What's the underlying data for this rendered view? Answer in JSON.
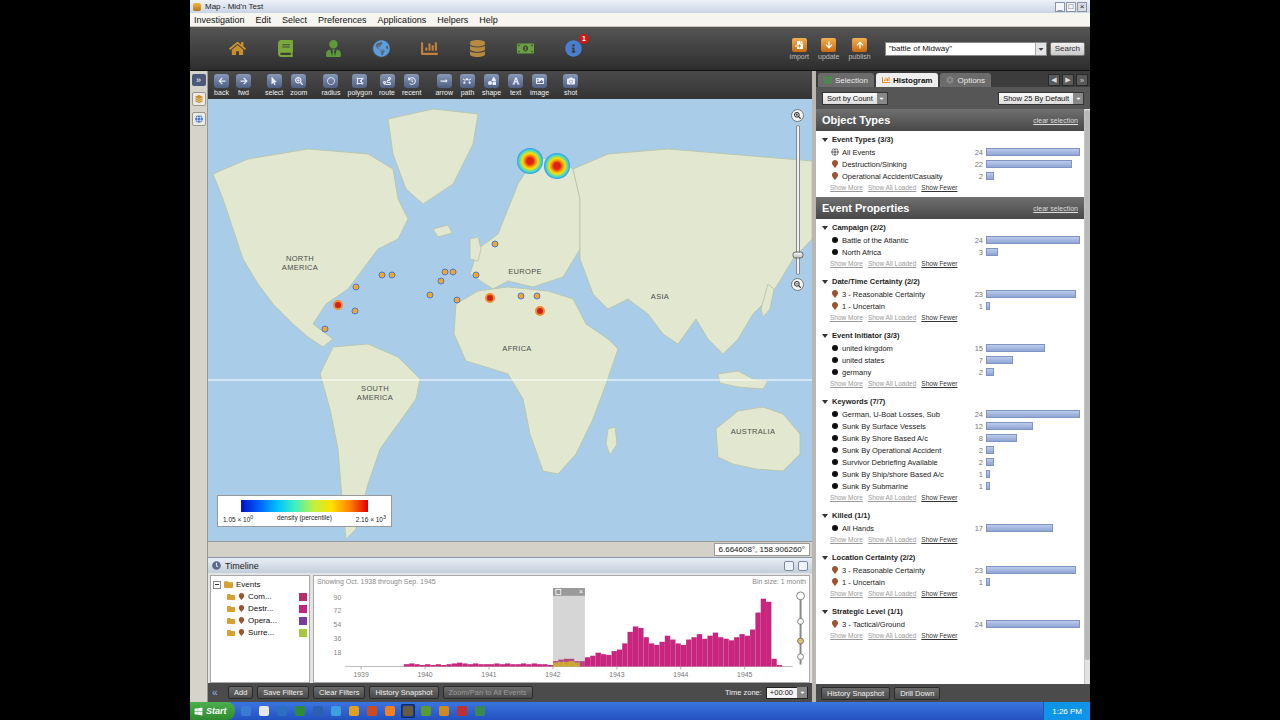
{
  "window": {
    "title": "Map - Mid'n Test",
    "controls": [
      "_",
      "□",
      "×"
    ]
  },
  "menu": [
    "Investigation",
    "Edit",
    "Select",
    "Preferences",
    "Applications",
    "Helpers",
    "Help"
  ],
  "toolbar": {
    "apps": [
      {
        "kind": "home",
        "selected": false
      },
      {
        "kind": "book",
        "selected": false
      },
      {
        "kind": "person",
        "selected": false
      },
      {
        "kind": "globe",
        "selected": true
      },
      {
        "kind": "chart",
        "selected": false
      },
      {
        "kind": "barrel",
        "selected": false
      },
      {
        "kind": "money",
        "selected": false
      },
      {
        "kind": "info",
        "selected": false,
        "badge": "1"
      }
    ],
    "actions": [
      {
        "kind": "import",
        "label": "import"
      },
      {
        "kind": "update",
        "label": "update"
      },
      {
        "kind": "publish",
        "label": "publish"
      }
    ],
    "search": {
      "value": "\"battle of Midway\"",
      "button": "Search"
    }
  },
  "side_strip": {
    "collapse": "»"
  },
  "map_toolbar": [
    [
      {
        "kind": "back",
        "label": "back"
      },
      {
        "kind": "fwd",
        "label": "fwd"
      }
    ],
    [
      {
        "kind": "select",
        "label": "select"
      },
      {
        "kind": "zoom",
        "label": "zoom"
      }
    ],
    [
      {
        "kind": "radius",
        "label": "radius"
      },
      {
        "kind": "polygon",
        "label": "polygon"
      },
      {
        "kind": "route",
        "label": "route"
      },
      {
        "kind": "recent",
        "label": "recent"
      }
    ],
    [
      {
        "kind": "arrow",
        "label": "arrow"
      },
      {
        "kind": "path",
        "label": "path"
      },
      {
        "kind": "shape",
        "label": "shape"
      },
      {
        "kind": "text",
        "label": "text"
      },
      {
        "kind": "image",
        "label": "image"
      }
    ],
    [
      {
        "kind": "shot",
        "label": "shot"
      }
    ]
  ],
  "map": {
    "labels": [
      {
        "label": "NORTH AMERICA",
        "lon": -90,
        "lat": 44.6
      },
      {
        "label": "EUROPE",
        "lon": 22.5,
        "lat": 41.8
      },
      {
        "label": "ASIA",
        "lon": 90,
        "lat": 31.7
      },
      {
        "label": "AFRICA",
        "lon": 18.5,
        "lat": 7.5
      },
      {
        "label": "SOUTH AMERICA",
        "lon": -52.5,
        "lat": -14.9
      },
      {
        "label": "AUSTRALIA",
        "lon": 136.5,
        "lat": -32.2
      }
    ],
    "pins": [
      {
        "kind": "heat",
        "lon": 25,
        "lat": 70.7,
        "color": "#e0201a"
      },
      {
        "kind": "heat",
        "lon": 38.5,
        "lat": 69.9,
        "color": "#e0201a"
      },
      {
        "kind": "point",
        "lon": 7.5,
        "lat": 51.3,
        "color": "#f5a623"
      },
      {
        "kind": "point",
        "lon": -49,
        "lat": 40.6,
        "color": "#f5a623"
      },
      {
        "kind": "point",
        "lon": -44,
        "lat": 40.6,
        "color": "#f5a623"
      },
      {
        "kind": "point",
        "lon": -17.5,
        "lat": 41.8,
        "color": "#f5a623"
      },
      {
        "kind": "point",
        "lon": -13.5,
        "lat": 41.8,
        "color": "#f5a623"
      },
      {
        "kind": "point",
        "lon": -2,
        "lat": 40.6,
        "color": "#f5a623"
      },
      {
        "kind": "point",
        "lon": -62,
        "lat": 35.8,
        "color": "#f5a623"
      },
      {
        "kind": "point",
        "lon": -19.5,
        "lat": 38.2,
        "color": "#f5a623"
      },
      {
        "kind": "point",
        "lon": -25,
        "lat": 32.6,
        "color": "#f5a623"
      },
      {
        "kind": "point",
        "lon": -11.5,
        "lat": 30.4,
        "color": "#f5a623"
      },
      {
        "kind": "major",
        "lon": 5,
        "lat": 31.3,
        "color": "#d0201a"
      },
      {
        "kind": "point",
        "lon": 20.5,
        "lat": 32.2,
        "color": "#f5a623"
      },
      {
        "kind": "point",
        "lon": 28.5,
        "lat": 32.2,
        "color": "#f5a623"
      },
      {
        "kind": "major",
        "lon": 30,
        "lat": 25.6,
        "color": "#d0201a"
      },
      {
        "kind": "major",
        "lon": -71,
        "lat": 28.2,
        "color": "#d0201a"
      },
      {
        "kind": "point",
        "lon": -62.5,
        "lat": 25.6,
        "color": "#f5a623"
      },
      {
        "kind": "point",
        "lon": -77.5,
        "lat": 17.3,
        "color": "#f5a623"
      }
    ],
    "legend": {
      "min_base": "1.05 × 10",
      "min_exp": "0",
      "caption": "density (percentile)",
      "max_base": "2.16 × 10",
      "max_exp": "3"
    },
    "zoom": {
      "level": 0.13
    },
    "coordinates": "6.664608°, 158.906260°"
  },
  "timeline": {
    "title": "Timeline",
    "tree": {
      "label": "Events",
      "expanded": true,
      "children": [
        {
          "label": "Com...",
          "color": "#b8306a"
        },
        {
          "label": "Destr...",
          "color": "#c0267e"
        },
        {
          "label": "Opera...",
          "color": "#7a3aa0"
        },
        {
          "label": "Surre...",
          "color": "#a8c83c"
        }
      ]
    },
    "range": "Showing Oct. 1938 through Sep. 1945",
    "bin": "Bin size: 1 month",
    "y_ticks": [
      "90",
      "72",
      "54",
      "36",
      "18"
    ],
    "x_ticks": [
      "1939",
      "1940",
      "1941",
      "1942",
      "1943",
      "1944",
      "1945"
    ],
    "series": [
      {
        "name": "Events",
        "color": "#c8267e",
        "values": [
          0,
          0,
          0,
          0,
          0,
          0,
          0,
          0,
          0,
          0,
          0,
          3,
          4,
          3,
          2,
          3,
          2,
          3,
          2,
          3,
          4,
          5,
          4,
          3,
          4,
          3,
          3,
          3,
          4,
          3,
          4,
          3,
          3,
          4,
          3,
          4,
          3,
          3,
          2,
          2,
          3,
          4,
          3,
          2,
          7,
          12,
          14,
          18,
          16,
          15,
          20,
          22,
          30,
          45,
          52,
          50,
          38,
          30,
          28,
          32,
          40,
          35,
          30,
          28,
          35,
          38,
          42,
          36,
          40,
          44,
          38,
          36,
          34,
          38,
          42,
          40,
          48,
          70,
          88,
          84,
          10,
          2,
          0,
          0
        ]
      },
      {
        "name": "Selection",
        "color": "#f0b400",
        "values": [
          0,
          0,
          0,
          0,
          0,
          0,
          0,
          0,
          0,
          0,
          0,
          0,
          0,
          0,
          0,
          0,
          0,
          0,
          0,
          0,
          0,
          0,
          0,
          0,
          0,
          0,
          0,
          0,
          0,
          0,
          0,
          0,
          0,
          0,
          0,
          0,
          0,
          0,
          0,
          5,
          6,
          6,
          7,
          5,
          0,
          0,
          0,
          0,
          0,
          0,
          0,
          0,
          0,
          0,
          0,
          0,
          0,
          0,
          0,
          0,
          0,
          0,
          0,
          0,
          0,
          0,
          0,
          0,
          0,
          0,
          0,
          0,
          0,
          0,
          0,
          0,
          0,
          0,
          0,
          0,
          0,
          0,
          0,
          0
        ]
      }
    ],
    "brush": {
      "from": 39,
      "to": 44,
      "close": "×"
    },
    "collapse": "«",
    "buttons": [
      {
        "label": "Add",
        "disabled": false
      },
      {
        "label": "Save Filters",
        "disabled": false
      },
      {
        "label": "Clear Filters",
        "disabled": false
      },
      {
        "label": "History Snapshot",
        "disabled": false
      },
      {
        "label": "Zoom/Pan to All Events",
        "disabled": true
      }
    ],
    "timezone_label": "Time zone:",
    "timezone": "+00:00"
  },
  "panel": {
    "tabs": [
      {
        "label": "Selection",
        "kind": "selection",
        "selected": false
      },
      {
        "label": "Histogram",
        "kind": "histogram",
        "selected": true
      },
      {
        "label": "Options",
        "kind": "options",
        "selected": false
      }
    ],
    "nav": [
      "◀",
      "▶"
    ],
    "collapse": "»",
    "sort": "Sort by Count",
    "show": "Show 25 By Default",
    "links": [
      {
        "label": "Show More",
        "disabled": true
      },
      {
        "label": "Show All Loaded",
        "disabled": true
      },
      {
        "label": "Show Fewer",
        "disabled": false
      }
    ],
    "sections": [
      {
        "title": "Object Types",
        "clear": "clear selection",
        "groups": [
          {
            "title": "Event Types (3/3)",
            "expanded": true,
            "items": [
              {
                "label": "All Events",
                "count": "24",
                "level": 1,
                "kind": "globe"
              },
              {
                "label": "Destruction/Sinking",
                "count": "22",
                "level": 0.917,
                "kind": "marker"
              },
              {
                "label": "Operational Accident/Casualty",
                "count": "2",
                "level": 0.083,
                "kind": "marker"
              }
            ]
          }
        ]
      },
      {
        "title": "Event Properties",
        "clear": "clear selection",
        "groups": [
          {
            "title": "Campaign (2/2)",
            "expanded": true,
            "items": [
              {
                "label": "Battle of the Atlantic",
                "count": "24",
                "level": 1,
                "kind": "dot"
              },
              {
                "label": "North Africa",
                "count": "3",
                "level": 0.125,
                "kind": "dot"
              }
            ]
          },
          {
            "title": "Date/Time Certainty (2/2)",
            "expanded": true,
            "items": [
              {
                "label": "3 - Reasonable Certainty",
                "count": "23",
                "level": 0.958,
                "kind": "marker"
              },
              {
                "label": "1 - Uncertain",
                "count": "1",
                "level": 0.042,
                "kind": "marker"
              }
            ]
          },
          {
            "title": "Event Initiator (3/3)",
            "expanded": true,
            "items": [
              {
                "label": "united kingdom",
                "count": "15",
                "level": 0.625,
                "kind": "dot"
              },
              {
                "label": "united states",
                "count": "7",
                "level": 0.29,
                "kind": "dot"
              },
              {
                "label": "germany",
                "count": "2",
                "level": 0.083,
                "kind": "dot"
              }
            ]
          },
          {
            "title": "Keywords (7/7)",
            "expanded": true,
            "items": [
              {
                "label": "German, U-Boat Losses, Sub",
                "count": "24",
                "level": 1,
                "kind": "dot"
              },
              {
                "label": "Sunk By Surface Vessels",
                "count": "12",
                "level": 0.5,
                "kind": "dot"
              },
              {
                "label": "Sunk By Shore Based A/c",
                "count": "8",
                "level": 0.333,
                "kind": "dot"
              },
              {
                "label": "Sunk By Operational Accident",
                "count": "2",
                "level": 0.083,
                "kind": "dot"
              },
              {
                "label": "Survivor Debriefing Available",
                "count": "2",
                "level": 0.083,
                "kind": "dot"
              },
              {
                "label": "Sunk By Ship/shore Based A/c",
                "count": "1",
                "level": 0.042,
                "kind": "dot"
              },
              {
                "label": "Sunk By Submarine",
                "count": "1",
                "level": 0.042,
                "kind": "dot"
              }
            ]
          },
          {
            "title": "Killed (1/1)",
            "expanded": true,
            "items": [
              {
                "label": "All Hands",
                "count": "17",
                "level": 0.708,
                "kind": "dot"
              }
            ]
          },
          {
            "title": "Location Certainty (2/2)",
            "expanded": true,
            "items": [
              {
                "label": "3 - Reasonable Certainty",
                "count": "23",
                "level": 0.958,
                "kind": "marker"
              },
              {
                "label": "1 - Uncertain",
                "count": "1",
                "level": 0.042,
                "kind": "marker"
              }
            ]
          },
          {
            "title": "Strategic Level (1/1)",
            "expanded": true,
            "items": [
              {
                "label": "3 - Tactical/Ground",
                "count": "24",
                "level": 1,
                "kind": "marker"
              }
            ]
          }
        ]
      }
    ],
    "footer": [
      "History Snapshot",
      "Drill Down"
    ]
  },
  "taskbar": {
    "start": "Start",
    "apps": [
      {
        "color": "#3a7bd5",
        "selected": false
      },
      {
        "color": "#e8e8e8",
        "selected": false
      },
      {
        "color": "#2f6fc0",
        "selected": false
      },
      {
        "color": "#2e8b3a",
        "selected": false
      },
      {
        "color": "#2c5fb0",
        "selected": false
      },
      {
        "color": "#3aa0e0",
        "selected": false
      },
      {
        "color": "#e0a020",
        "selected": false
      },
      {
        "color": "#d04a20",
        "selected": false
      },
      {
        "color": "#f08020",
        "selected": false
      },
      {
        "color": "#6a5a40",
        "selected": true
      },
      {
        "color": "#5a9a30",
        "selected": false
      },
      {
        "color": "#d08a20",
        "selected": false
      },
      {
        "color": "#c03030",
        "selected": false
      },
      {
        "color": "#3a8a50",
        "selected": false
      }
    ],
    "time": "1:26 PM"
  }
}
